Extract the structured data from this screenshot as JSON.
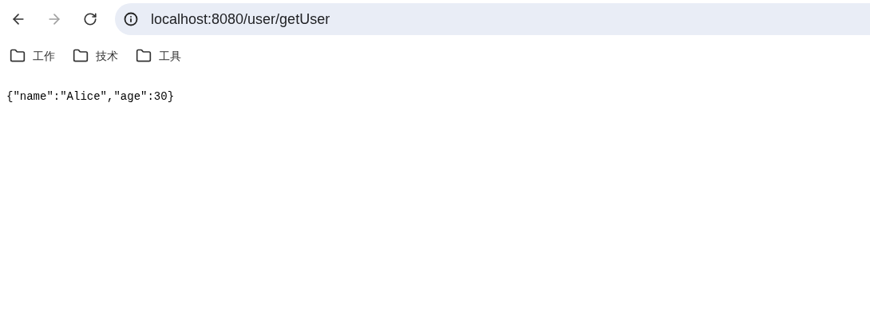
{
  "toolbar": {
    "back": {
      "disabled": false
    },
    "forward": {
      "disabled": true
    }
  },
  "address_bar": {
    "url": "localhost:8080/user/getUser"
  },
  "bookmarks": [
    {
      "label": "工作"
    },
    {
      "label": "技术"
    },
    {
      "label": "工具"
    }
  ],
  "page": {
    "body": "{\"name\":\"Alice\",\"age\":30}"
  }
}
